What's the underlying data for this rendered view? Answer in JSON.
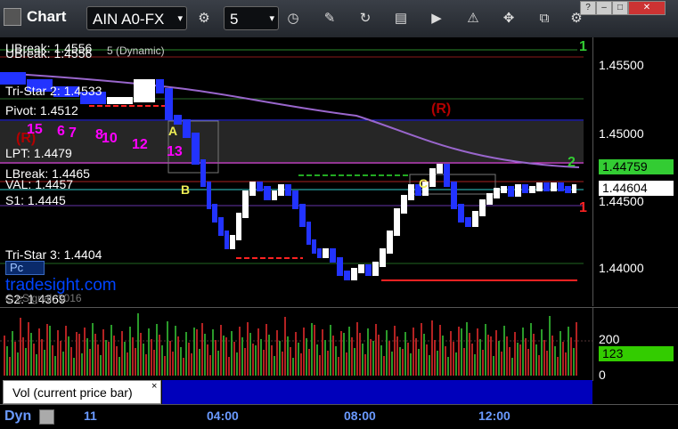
{
  "toolbar": {
    "title": "Chart",
    "symbol": "AIN A0-FX",
    "interval": "5",
    "win_help": "?",
    "win_min": "–",
    "win_max": "□",
    "win_close": "✕"
  },
  "levels": {
    "ubreak": "UBreak: 1.4556",
    "ubreak_dup": "UBreak: 1.4556",
    "tristar2": "Tri-Star 2: 1.4533",
    "pivot": "Pivot: 1.4512",
    "lpt": "LPT: 1.4479",
    "lbreak": "LBreak: 1.4465",
    "val": "VAL: 1.4457",
    "s1": "S1: 1.4445",
    "tristar3": "Tri-Star 3: 1.4404",
    "s2": "S2: 1.4369",
    "ma_label": "5 (Dynamic)"
  },
  "axis": {
    "ticks": [
      "1.45500",
      "1.45000",
      "1.44500",
      "1.44000"
    ],
    "last_price": "1.44759",
    "current_price": "1.44604",
    "vol_ticks": [
      "200",
      "0"
    ],
    "vol_current": "123"
  },
  "annotations": {
    "r_top": "(R)",
    "r_left": "(R)",
    "A": "A",
    "B": "B",
    "C": "C",
    "pc": "Pc",
    "n15": "15",
    "n6": "6",
    "n7": "7",
    "n8": "8",
    "n10": "10",
    "n12": "12",
    "n13": "13",
    "one_green": "1",
    "one_red": "1",
    "two_green": "2"
  },
  "watermark": {
    "brand": "tradesight.com",
    "copyright": "© eSignal, 2016"
  },
  "volume_panel": {
    "tab_label": "Vol (current price bar)",
    "close": "×"
  },
  "timeaxis": {
    "tag": "Dyn",
    "day": "11",
    "times": [
      "04:00",
      "08:00",
      "12:00"
    ]
  },
  "colors": {
    "up_bar": "#ffffff",
    "down_bar": "#2233ff",
    "magenta": "#ff00ff",
    "dark_red": "#b30000",
    "green_tag": "#33cc33",
    "ma": "#9966cc"
  }
}
